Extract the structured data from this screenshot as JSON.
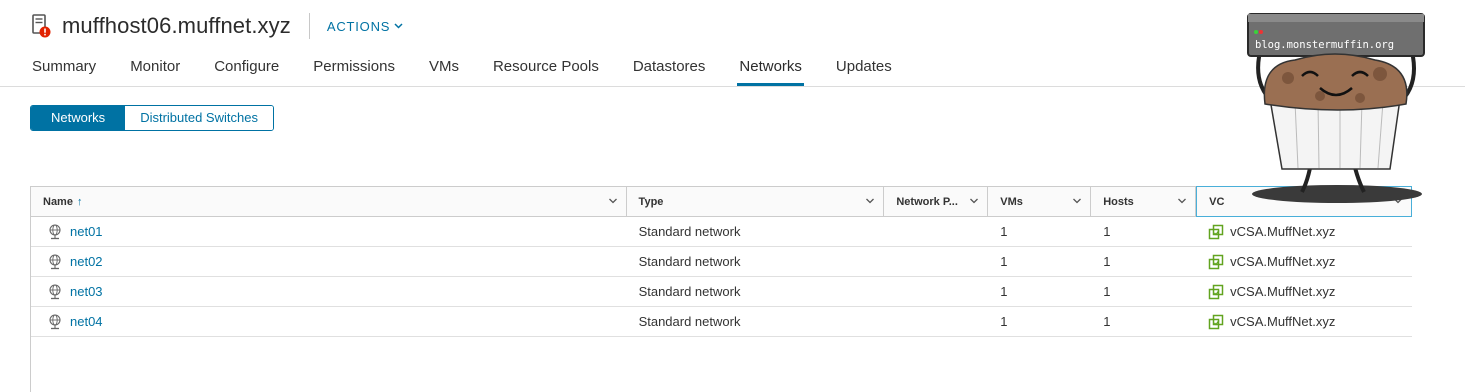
{
  "header": {
    "host_name": "muffhost06.muffnet.xyz",
    "actions_label": "ACTIONS",
    "host_icon": "host-warning-icon"
  },
  "tabs": [
    {
      "label": "Summary",
      "active": false
    },
    {
      "label": "Monitor",
      "active": false
    },
    {
      "label": "Configure",
      "active": false
    },
    {
      "label": "Permissions",
      "active": false
    },
    {
      "label": "VMs",
      "active": false
    },
    {
      "label": "Resource Pools",
      "active": false
    },
    {
      "label": "Datastores",
      "active": false
    },
    {
      "label": "Networks",
      "active": true
    },
    {
      "label": "Updates",
      "active": false
    }
  ],
  "segments": [
    {
      "label": "Networks",
      "active": true
    },
    {
      "label": "Distributed Switches",
      "active": false
    }
  ],
  "grid": {
    "columns": [
      "Name",
      "Type",
      "Network P...",
      "VMs",
      "Hosts",
      "VC"
    ],
    "sort_indicator": "↑",
    "rows": [
      {
        "name": "net01",
        "type": "Standard network",
        "network_protocol": "",
        "vms": "1",
        "hosts": "1",
        "vc": "vCSA.MuffNet.xyz"
      },
      {
        "name": "net02",
        "type": "Standard network",
        "network_protocol": "",
        "vms": "1",
        "hosts": "1",
        "vc": "vCSA.MuffNet.xyz"
      },
      {
        "name": "net03",
        "type": "Standard network",
        "network_protocol": "",
        "vms": "1",
        "hosts": "1",
        "vc": "vCSA.MuffNet.xyz"
      },
      {
        "name": "net04",
        "type": "Standard network",
        "network_protocol": "",
        "vms": "1",
        "hosts": "1",
        "vc": "vCSA.MuffNet.xyz"
      }
    ]
  },
  "watermark": {
    "text": "blog.monstermuffin.org"
  },
  "colors": {
    "accent": "#0072a3",
    "vc_icon": "#62a420",
    "warning": "#e12200"
  }
}
